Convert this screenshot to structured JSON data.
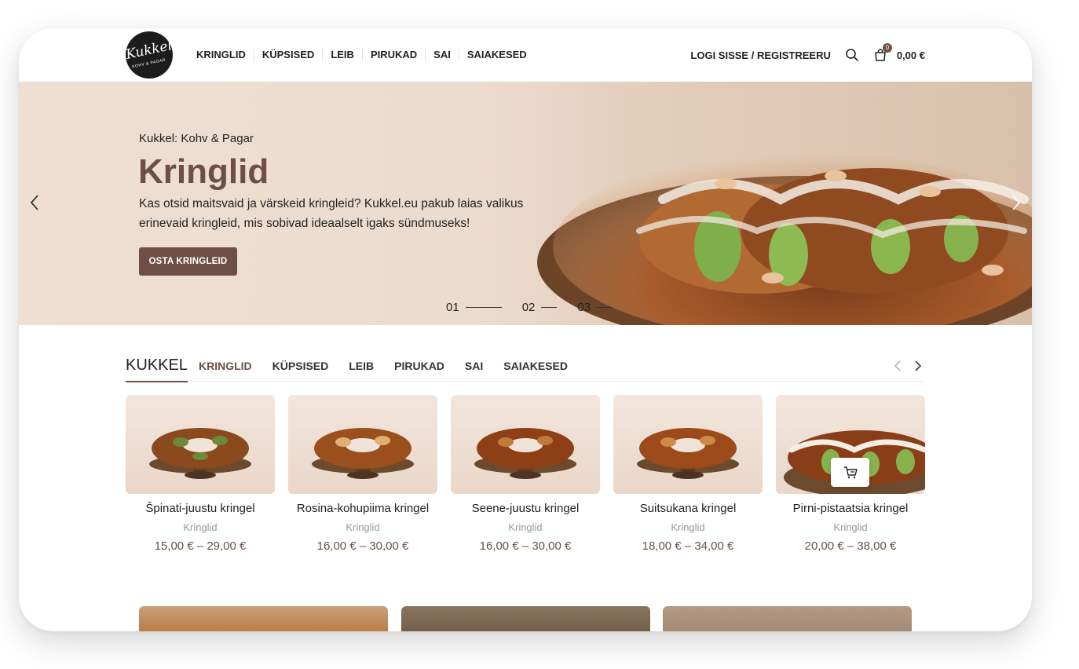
{
  "logo": {
    "word": "Kukkel",
    "sub": "KOHV & PAGAR"
  },
  "nav": {
    "items": [
      "KRINGLID",
      "KÜPSISED",
      "LEIB",
      "PIRUKAD",
      "SAI",
      "SAIAKESED"
    ],
    "login": "LOGI SISSE / REGISTREERU",
    "cart_count": "0",
    "cart_total": "0,00 €",
    "search_icon": "search-icon",
    "cart_icon": "shopping-bag-icon"
  },
  "hero": {
    "subtitle": "Kukkel: Kohv & Pagar",
    "title": "Kringlid",
    "description": "Kas otsid maitsvaid ja värskeid kringleid? Kukkel.eu pakub laias valikus erinevaid kringleid, mis sobivad ideaalselt igaks sündmuseks!",
    "cta": "OSTA KRINGLEID",
    "slides": [
      "01",
      "02",
      "03"
    ],
    "active_slide": 0,
    "prev_icon": "chevron-left-icon",
    "next_icon": "chevron-right-icon"
  },
  "tabs": {
    "title": "KUKKEL",
    "items": [
      "KRINGLID",
      "KÜPSISED",
      "LEIB",
      "PIRUKAD",
      "SAI",
      "SAIAKESED"
    ],
    "active": 0
  },
  "products": [
    {
      "name": "Špinati-juustu kringel",
      "category": "Kringlid",
      "price": "15,00 € – 29,00 €"
    },
    {
      "name": "Rosina-kohupiima kringel",
      "category": "Kringlid",
      "price": "16,00 € – 30,00 €"
    },
    {
      "name": "Seene-juustu kringel",
      "category": "Kringlid",
      "price": "16,00 € – 30,00 €"
    },
    {
      "name": "Suitsukana kringel",
      "category": "Kringlid",
      "price": "18,00 € – 34,00 €"
    },
    {
      "name": "Pirni-pistaatsia kringel",
      "category": "Kringlid",
      "price": "20,00 € – 38,00 €"
    }
  ],
  "colors": {
    "accent": "#6e4f43",
    "hero_bg": "#ecdccf",
    "text": "#222222",
    "muted": "#999999"
  }
}
